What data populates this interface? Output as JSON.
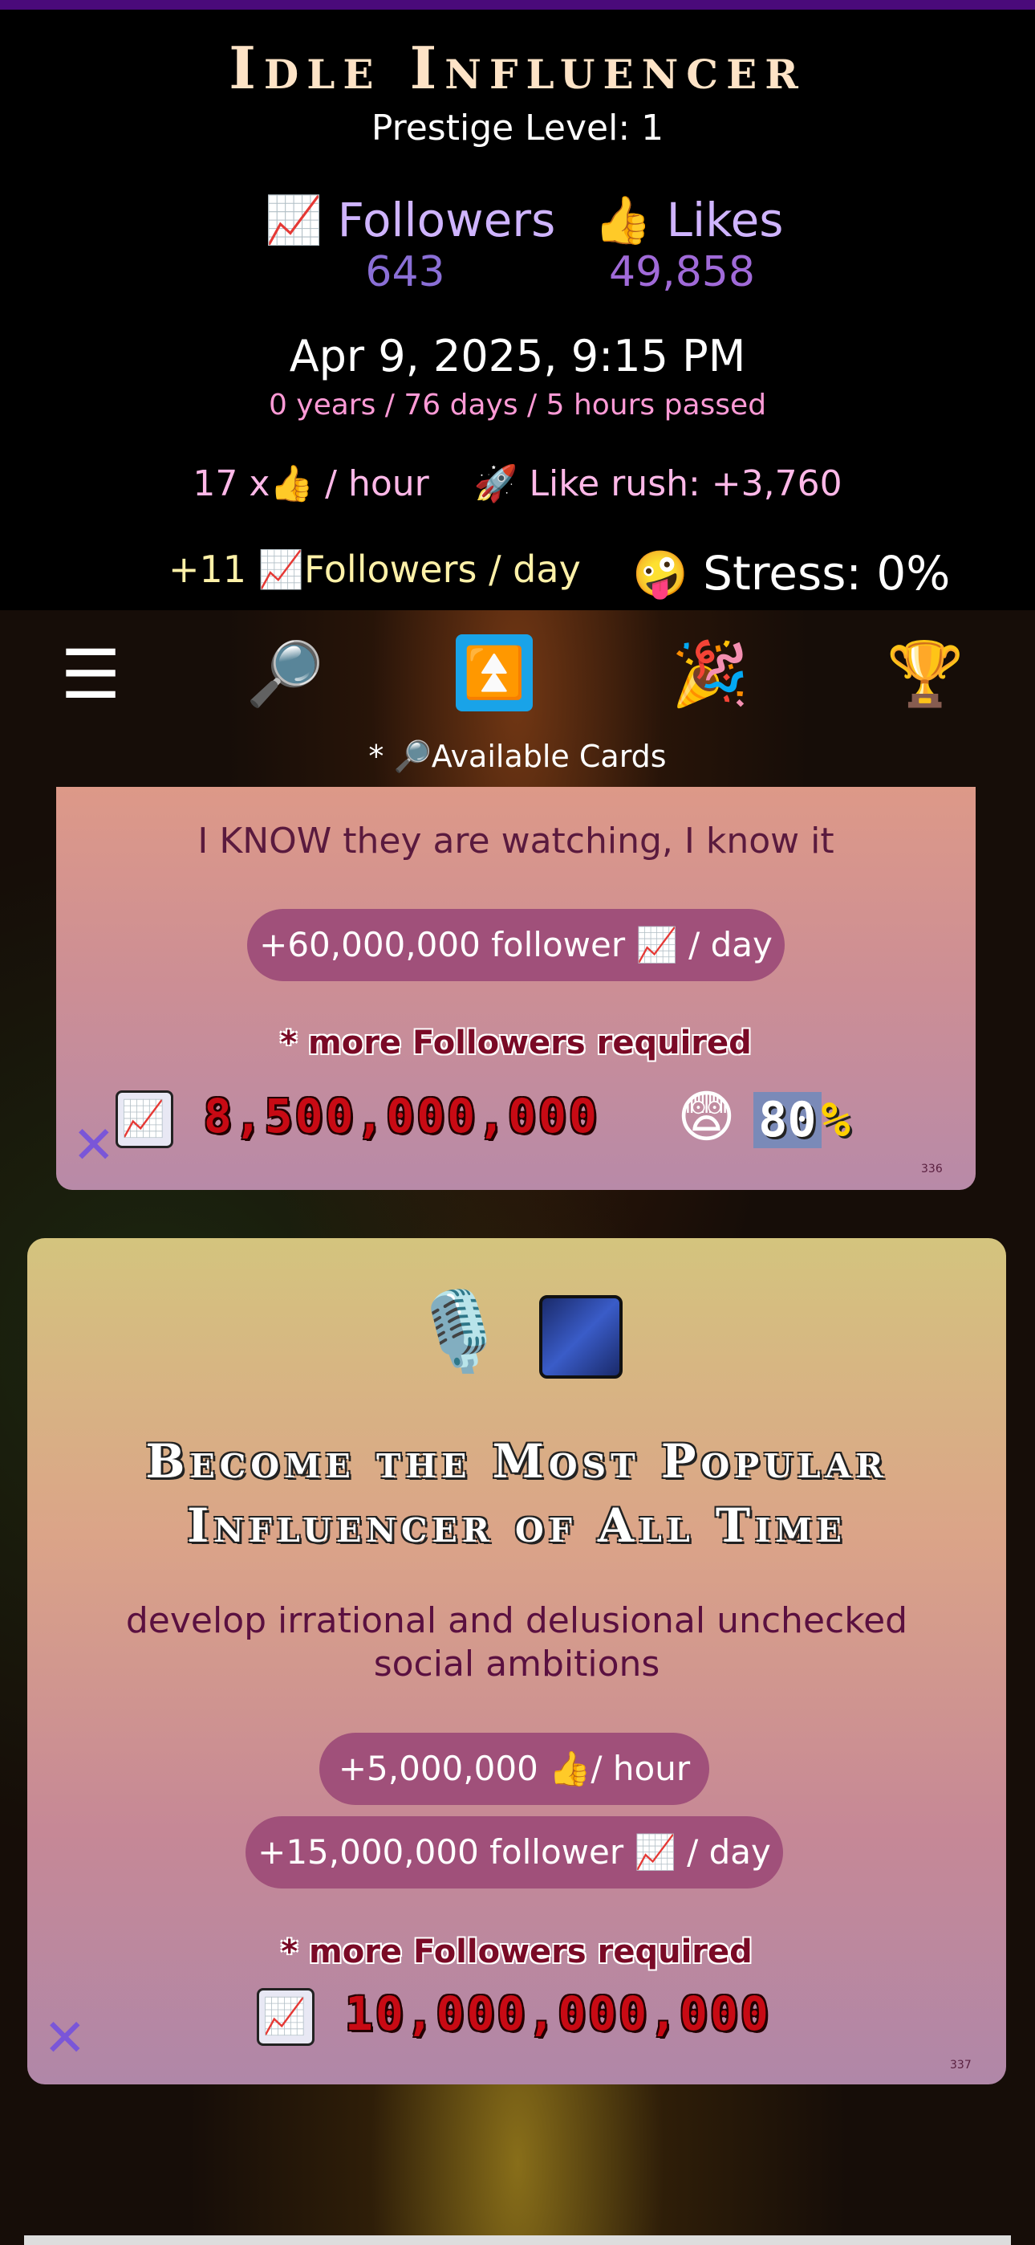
{
  "header": {
    "title": "Idle Influencer",
    "prestige": "Prestige Level: 1",
    "followers": {
      "icon": "📈",
      "label": "Followers",
      "value": "643"
    },
    "likes": {
      "icon": "👍",
      "label": "Likes",
      "value": "49,858"
    },
    "datetime": "Apr 9, 2025, 9:15 PM",
    "elapsed": "0 years / 76 days / 5 hours passed",
    "likes_rate": "17 x👍 / hour",
    "like_rush": "🚀 Like rush: +3,760",
    "followers_day": "+11 📈Followers / day",
    "stress_icon": "🤪",
    "stress": "Stress: 0%"
  },
  "toolbar": {
    "menu_icon": "☰",
    "search_icon": "🔎",
    "upgrade_icon": "⏫",
    "party_icon": "🎉",
    "trophy_icon": "🏆"
  },
  "available_cards": "* 🔎Available Cards",
  "cards": [
    {
      "quote": "I KNOW they are watching, I know it",
      "reward": "+60,000,000 follower 📈 / day",
      "requirement": "* more Followers required",
      "cost_icon": "📈",
      "cost": "8,500,000,000",
      "stress_icon": "😨",
      "stress_value": "80",
      "stress_sign": "%",
      "close": "✕",
      "number": "336"
    },
    {
      "icons": "🎙️",
      "title_line1": "Become the Most Popular",
      "title_line2": "Influencer of All Time",
      "description": "develop irrational and delusional unchecked social ambitions",
      "reward1": "+5,000,000 👍/ hour",
      "reward2": "+15,000,000 follower 📈 / day",
      "requirement": "* more Followers required",
      "cost_icon": "📈",
      "cost": "10,000,000,000",
      "close": "✕",
      "number": "337"
    }
  ],
  "colors": {
    "title": "#fde3c6",
    "followers_label": "#cfb4ff",
    "elapsed": "#ff9ad6",
    "upgrade_button": "#19a3e8",
    "pill": "#a0507a",
    "cost_text": "#c80a14",
    "close": "#7a56d8"
  }
}
